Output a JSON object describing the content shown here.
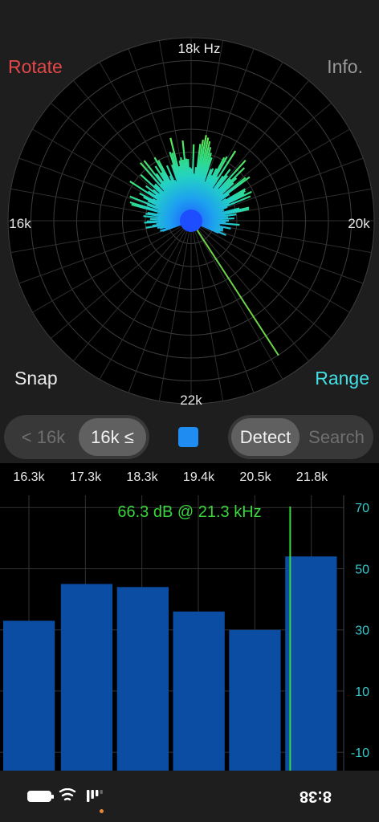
{
  "polar": {
    "buttons": {
      "rotate": "Rotate",
      "info": "Info.",
      "snap": "Snap",
      "range": "Range"
    },
    "labels": {
      "top": "18k Hz",
      "left": "16k",
      "right": "20k",
      "bottom": "22k"
    },
    "rings": 8,
    "spokes": 36,
    "spectrum_colors": [
      "#1e5bff",
      "#1da0f0",
      "#23d1c4",
      "#35e07c",
      "#6bea4d"
    ]
  },
  "controls": {
    "range_low": "< 16k",
    "range_high": "16k ≤",
    "range_selected": "high",
    "mode_detect": "Detect",
    "mode_search": "Search",
    "mode_selected": "detect",
    "swatch_color": "#1e8cf0"
  },
  "readout": "66.3 dB @ 21.3 kHz",
  "chart_data": {
    "type": "bar",
    "categories": [
      "16.3k",
      "17.3k",
      "18.3k",
      "19.4k",
      "20.5k",
      "21.8k"
    ],
    "values": [
      33,
      45,
      44,
      36,
      30,
      54
    ],
    "ylim": [
      -16,
      74
    ],
    "yticks": [
      -10,
      10,
      30,
      50,
      70
    ],
    "marker_khz": 21.3,
    "bar_color": "#0a4da2",
    "marker_color": "#39d63c",
    "tick_color": "#37c8cc",
    "xlabel": "",
    "ylabel": ""
  },
  "status": {
    "time": "8:38",
    "icons": [
      "battery-icon",
      "wifi-icon",
      "signal-icon"
    ]
  }
}
